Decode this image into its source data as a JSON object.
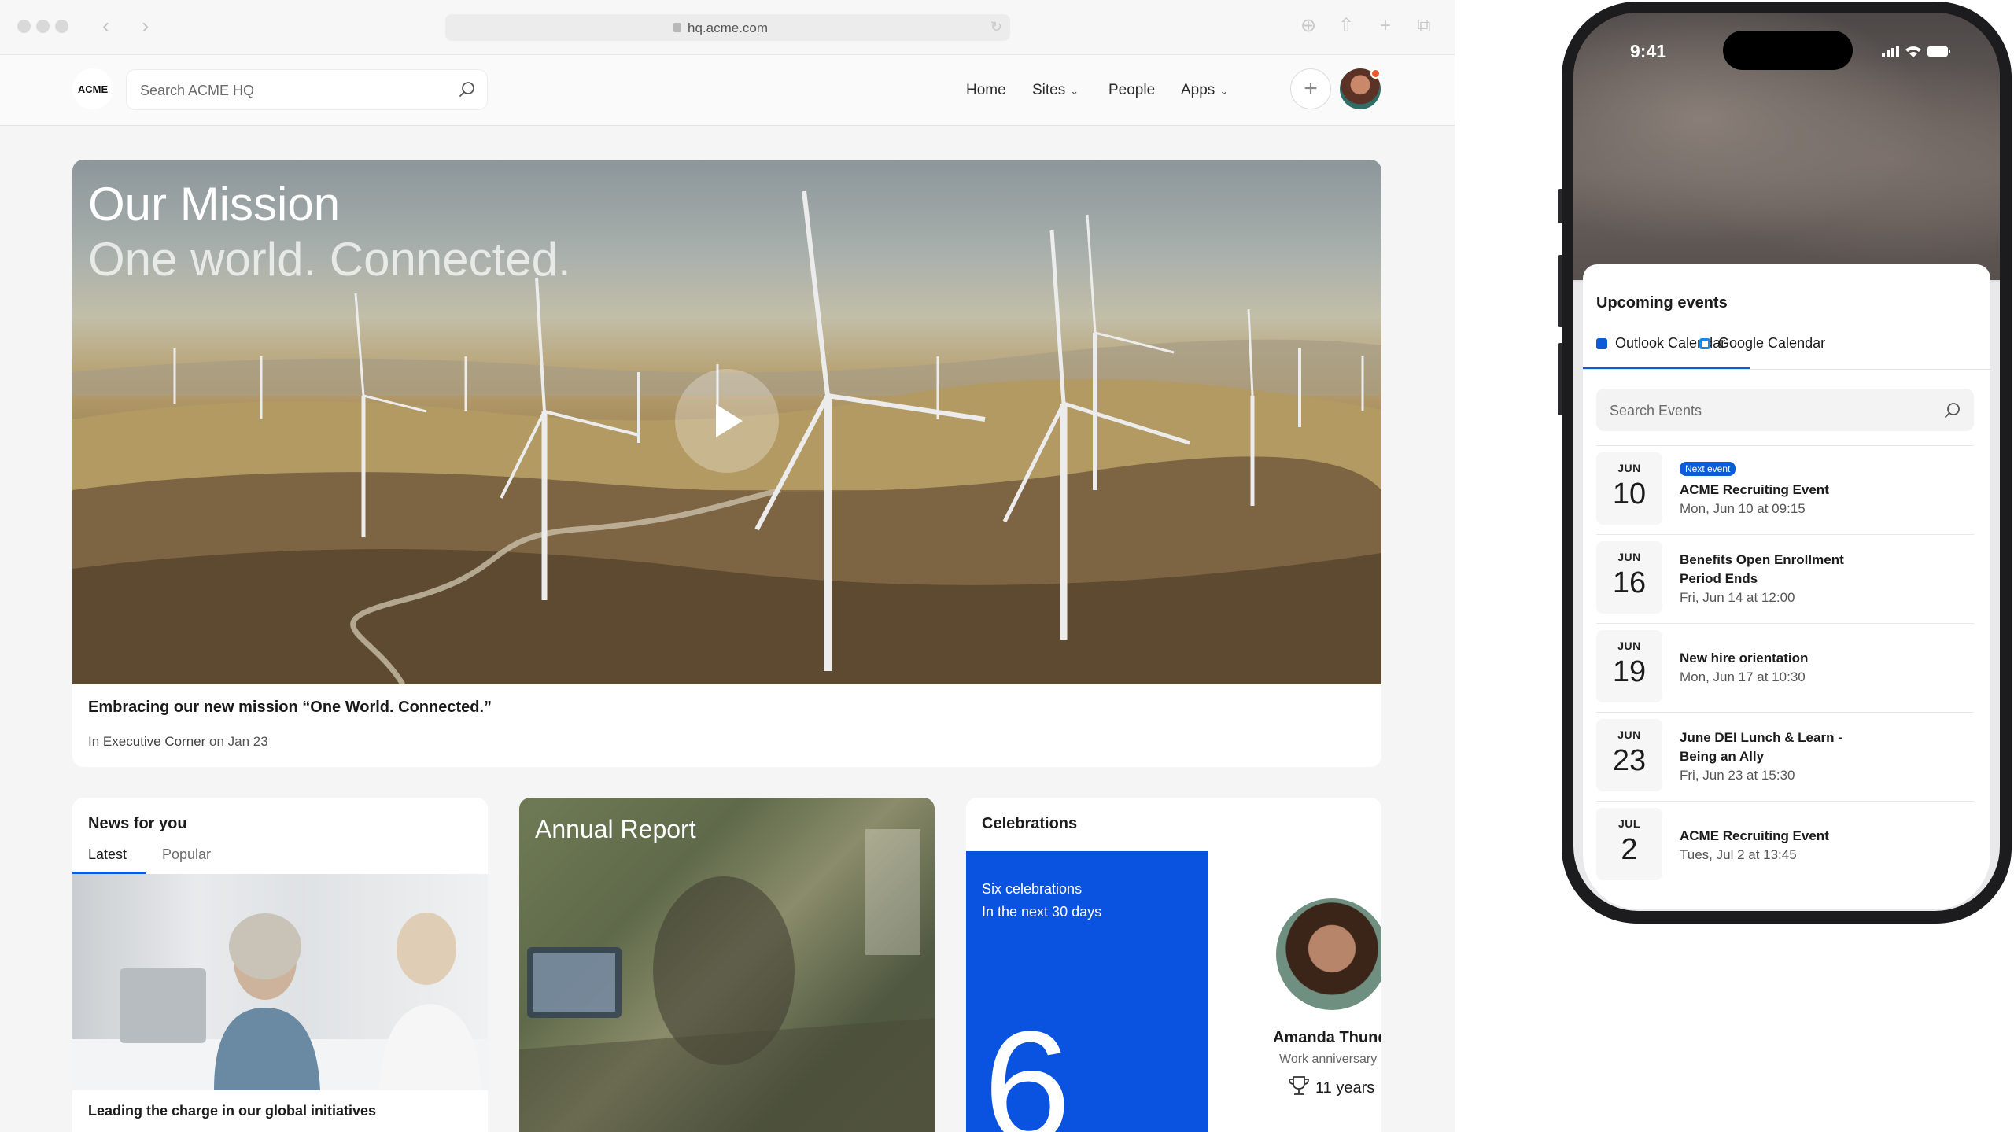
{
  "browser": {
    "url": "hq.acme.com"
  },
  "header": {
    "logo": "ACME",
    "search_placeholder": "Search ACME HQ",
    "nav": [
      {
        "label": "Home"
      },
      {
        "label": "Sites"
      },
      {
        "label": "People"
      },
      {
        "label": "Apps"
      }
    ]
  },
  "hero": {
    "title": "Our Mission",
    "subtitle": "One world. Connected.",
    "caption": "Embracing our new mission “One World. Connected.”",
    "meta_prefix": "In ",
    "meta_link": "Executive Corner",
    "meta_suffix": " on Jan 23"
  },
  "news": {
    "title": "News for you",
    "tabs": [
      "Latest",
      "Popular"
    ],
    "headline": "Leading the charge in our global initiatives"
  },
  "report": {
    "title": "Annual Report"
  },
  "celebrations": {
    "title": "Celebrations",
    "summary": "Six celebrations\nIn the next 30 days",
    "count": "6",
    "person_name": "Amanda Thunder",
    "person_sub": "Work anniversary",
    "person_years": "11 years"
  },
  "phone": {
    "time": "9:41",
    "sheet_title": "Upcoming events",
    "tabs": [
      {
        "label": "Outlook Calendar",
        "icon_color": "#0b5cd6"
      },
      {
        "label": "Google Calendar",
        "icon_color": "#1e88e5"
      }
    ],
    "search_placeholder": "Search Events",
    "events": [
      {
        "month": "JUN",
        "day": "10",
        "badge": "Next event",
        "title": "ACME Recruiting Event",
        "time": "Mon, Jun 10 at 09:15"
      },
      {
        "month": "JUN",
        "day": "16",
        "badge": "",
        "title": "Benefits Open Enrollment\nPeriod Ends",
        "time": "Fri, Jun 14 at 12:00"
      },
      {
        "month": "JUN",
        "day": "19",
        "badge": "",
        "title": "New hire orientation",
        "time": "Mon, Jun 17 at 10:30"
      },
      {
        "month": "JUN",
        "day": "23",
        "badge": "",
        "title": "June DEI Lunch & Learn -\nBeing an Ally",
        "time": "Fri, Jun 23 at 15:30"
      },
      {
        "month": "JUL",
        "day": "2",
        "badge": "",
        "title": "ACME Recruiting Event",
        "time": "Tues, Jul 2 at 13:45"
      }
    ]
  },
  "colors": {
    "accent": "#0b5cd6",
    "celebration_blue": "#0a53e0"
  }
}
